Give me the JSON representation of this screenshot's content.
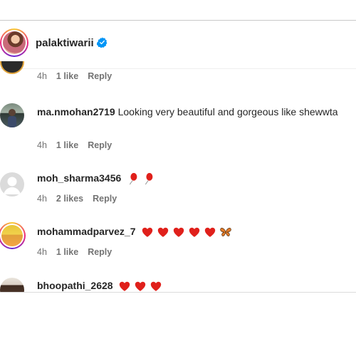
{
  "post_header": {
    "username": "palaktiwarii",
    "verified": true
  },
  "comments": [
    {
      "username": "",
      "text": "",
      "time": "4h",
      "likes": "1 like",
      "reply": "Reply",
      "partial": true
    },
    {
      "username": "ma.nmohan2719",
      "text": "Looking very beautiful and gorgeous like shewwta",
      "time": "4h",
      "likes": "1 like",
      "reply": "Reply"
    },
    {
      "username": "moh_sharma3456",
      "text": "",
      "emojis": [
        "balloon-icon",
        "balloon-icon"
      ],
      "time": "4h",
      "likes": "2 likes",
      "reply": "Reply"
    },
    {
      "username": "mohammadparvez_7",
      "text": "",
      "emojis": [
        "heart-icon",
        "heart-icon",
        "heart-icon",
        "heart-icon",
        "heart-icon",
        "butterfly-icon"
      ],
      "time": "4h",
      "likes": "1 like",
      "reply": "Reply"
    },
    {
      "username": "bhoopathi_2628",
      "text": "",
      "emojis": [
        "heart-icon",
        "heart-icon",
        "heart-icon"
      ]
    }
  ],
  "colors": {
    "text": "#262626",
    "meta": "#737373",
    "verified_blue": "#0095f6",
    "heart_red": "#e0201b"
  }
}
